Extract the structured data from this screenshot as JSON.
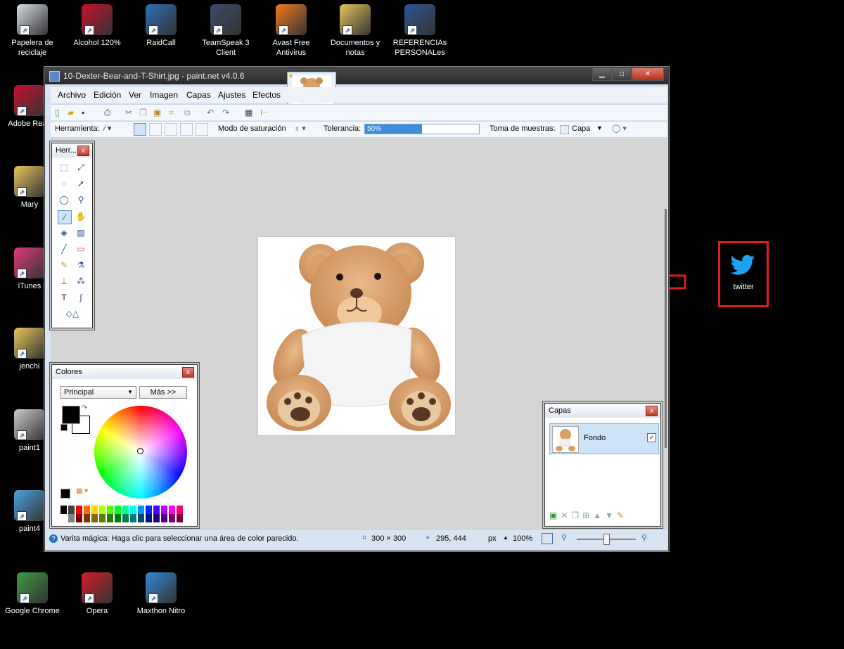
{
  "desktop": {
    "top_icons": [
      {
        "label_l1": "Papelera de",
        "label_l2": "reciclaje",
        "icon": "recycle-bin-icon",
        "color": "#d8dde4"
      },
      {
        "label_l1": "Alcohol 120%",
        "label_l2": "",
        "icon": "alcohol-icon",
        "color": "#c8102e"
      },
      {
        "label_l1": "RaidCall",
        "label_l2": "",
        "icon": "raidcall-icon",
        "color": "#2a6fb6"
      },
      {
        "label_l1": "TeamSpeak 3",
        "label_l2": "Client",
        "icon": "teamspeak-icon",
        "color": "#3c4b6a"
      },
      {
        "label_l1": "Avast Free",
        "label_l2": "Antivirus",
        "icon": "avast-icon",
        "color": "#f27b1b"
      },
      {
        "label_l1": "Documentos y",
        "label_l2": "notas",
        "icon": "folder-icon",
        "color": "#e8c55a"
      },
      {
        "label_l1": "REFERENCIAs",
        "label_l2": "PERSONALes",
        "icon": "word-document-icon",
        "color": "#2b5797"
      }
    ],
    "left_icons": [
      {
        "label": "Adobe Read",
        "icon": "adobe-reader-icon",
        "color": "#c8102e"
      },
      {
        "label": "Mary",
        "icon": "folder-icon",
        "color": "#e8c55a"
      },
      {
        "label": "iTunes",
        "icon": "itunes-icon",
        "color": "#e23a7d"
      },
      {
        "label": "jenchi",
        "icon": "folder-icon",
        "color": "#e8c55a"
      },
      {
        "label": "paint1",
        "icon": "image-file-icon",
        "color": "#cccccc"
      },
      {
        "label": "paint4",
        "icon": "image-file-icon",
        "color": "#4aa3df"
      }
    ],
    "bottom_icons": [
      {
        "label": "Google Chrome",
        "icon": "chrome-icon",
        "color": "#3c9c43"
      },
      {
        "label": "Opera",
        "icon": "opera-icon",
        "color": "#d41e26"
      },
      {
        "label": "Maxthon Nitro",
        "icon": "maxthon-nitro-icon",
        "color": "#2f8ad8"
      }
    ],
    "twitter": {
      "label": "twitter",
      "color": "#1da1f2",
      "highlight_color": "#e11b22"
    }
  },
  "window": {
    "title": "10-Dexter-Bear-and-T-Shirt.jpg - paint.net v4.0.6",
    "menu": [
      "Archivo",
      "Edición",
      "Ver",
      "Imagen",
      "Capas",
      "Ajustes",
      "Efectos"
    ],
    "toolbar2": {
      "tool_label": "Herramienta:",
      "mode_label": "Modo de saturación",
      "tolerance_label": "Tolerancia:",
      "tolerance_value": "50%",
      "tolerance_fraction": 0.5,
      "sample_label": "Toma de muestras:",
      "sample_value": "Capa"
    },
    "status": {
      "hint": "Varita mágica: Haga clic para seleccionar una área de color parecido.",
      "image_size": "300 × 300",
      "cursor_pos": "295, 444",
      "unit": "px",
      "zoom": "100%"
    }
  },
  "tools_panel": {
    "title": "Herr...",
    "close": "x"
  },
  "colors_panel": {
    "title": "Colores",
    "close": "x",
    "mode": "Principal",
    "more_button": "Más >>"
  },
  "layers_panel": {
    "title": "Capas",
    "close": "x",
    "layer_name": "Fondo",
    "checkbox": "✓"
  },
  "accent": "#3b8fd6"
}
